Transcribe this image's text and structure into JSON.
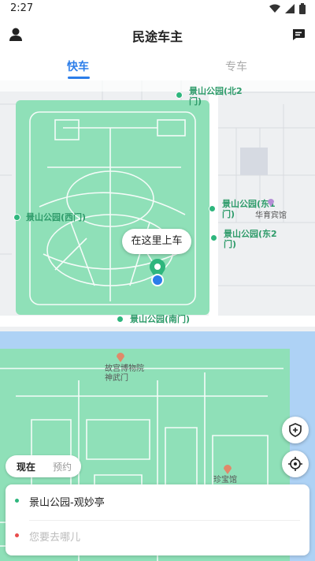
{
  "status_bar": {
    "time": "2:27"
  },
  "header": {
    "title": "民途车主"
  },
  "tabs": [
    {
      "label": "快车",
      "active": true
    },
    {
      "label": "专车",
      "active": false
    }
  ],
  "map": {
    "gates": {
      "north": "景山公园(北2门)",
      "west": "景山公园(西门)",
      "east1": "景山公园(东1门)",
      "east2": "景山公园(东2门)",
      "south": "景山公园(南门)"
    },
    "pois": {
      "hotel": "华育宾馆",
      "museum": "故宫博物院神武门",
      "treasure": "珍宝馆"
    },
    "pickup_label": "在这里上车"
  },
  "time_toggle": {
    "now": "现在",
    "book": "预约"
  },
  "route": {
    "from": "景山公园-观妙亭",
    "to_placeholder": "您要去哪儿"
  },
  "colors": {
    "accent": "#2b7de9",
    "park": "#8fe0b8",
    "water": "#aed2f5",
    "start": "#2eb67d",
    "end": "#e84c4c"
  }
}
